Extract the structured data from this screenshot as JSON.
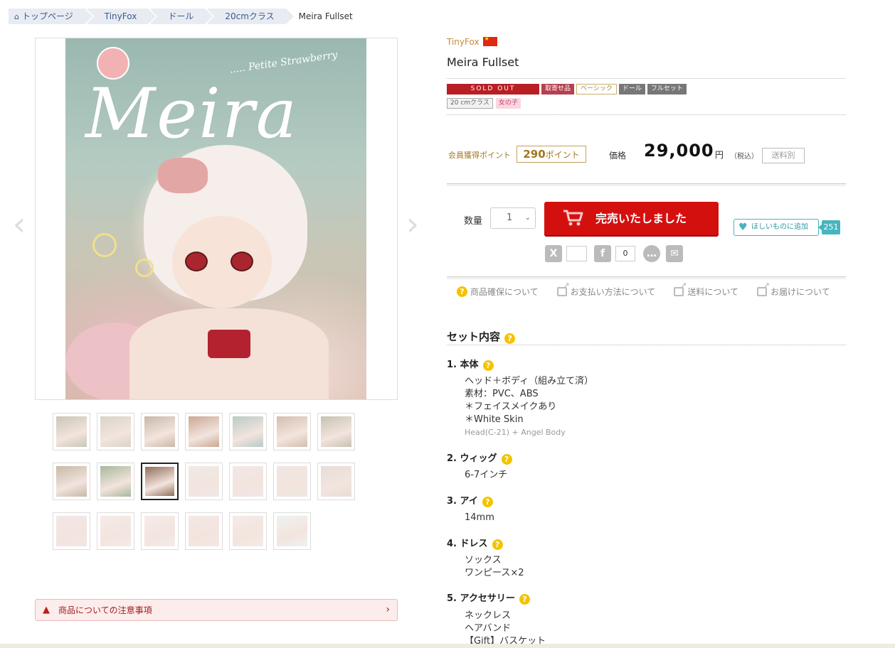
{
  "breadcrumb": {
    "items": [
      "トップページ",
      "TinyFox",
      "ドール",
      "20cmクラス"
    ],
    "current": "Meira Fullset"
  },
  "gallery": {
    "main_logo": "Meira",
    "main_logo_sub": "..... Petite Strawberry",
    "thumb_colors": [
      "#c9c6b6",
      "#d8d4c8",
      "#c9b8a8",
      "#caa894",
      "#b9cbc6",
      "#d3bfae",
      "#c7c2b2",
      "#c7b8a6",
      "#a8b89a",
      "#8f6e58",
      "#eeeae6",
      "#f0e8e8",
      "#efe6e2",
      "#e8ddd8",
      "#f2e6e6",
      "#f4ebe8",
      "#f4ecea",
      "#f3e8e6",
      "#f3ebe8",
      "#eef2f2"
    ],
    "selected_thumb": 9
  },
  "notice": "商品についての注意事項",
  "product": {
    "brand": "TinyFox",
    "title": "Meira Fullset",
    "tags": [
      "SOLD OUT",
      "取寄せ品",
      "ベーシック",
      "ドール",
      "フルセット"
    ],
    "tags2": [
      "20 cmクラス",
      "女の子"
    ],
    "points_label": "会員獲得ポイント",
    "points_value": "290",
    "points_unit": "ポイント",
    "price_label": "価格",
    "price": "29,000",
    "yen": "円",
    "tax": "（税込）",
    "shipping": "送料別"
  },
  "purchase": {
    "qty_label": "数量",
    "qty_value": "1",
    "buy_label": "完売いたしました",
    "wish_label": "ほしいものに追加",
    "wish_count": "251",
    "share_fb_count": "0"
  },
  "links": [
    "商品確保について",
    "お支払い方法について",
    "送料について",
    "お届けについて"
  ],
  "set": {
    "title": "セット内容",
    "sections": [
      {
        "label": "1. 本体",
        "lines": [
          "ヘッド＋ボディ（組み立て済）",
          "素材：PVC、ABS",
          "＊フェイスメイクあり",
          "＊White Skin"
        ],
        "sub": "Head(C-21) + Angel Body"
      },
      {
        "label": "2. ウィッグ",
        "lines": [
          "6-7インチ"
        ]
      },
      {
        "label": "3. アイ",
        "lines": [
          "14mm"
        ]
      },
      {
        "label": "4. ドレス",
        "lines": [
          "ソックス",
          "ワンピース×2"
        ]
      },
      {
        "label": "5. アクセサリー",
        "lines": [
          "ネックレス",
          "ヘアバンド",
          "【Gift】バスケット"
        ]
      }
    ]
  },
  "colors": {
    "accent": "#d4100f",
    "brand": "#c68a3a",
    "wish": "#45b5c0"
  }
}
